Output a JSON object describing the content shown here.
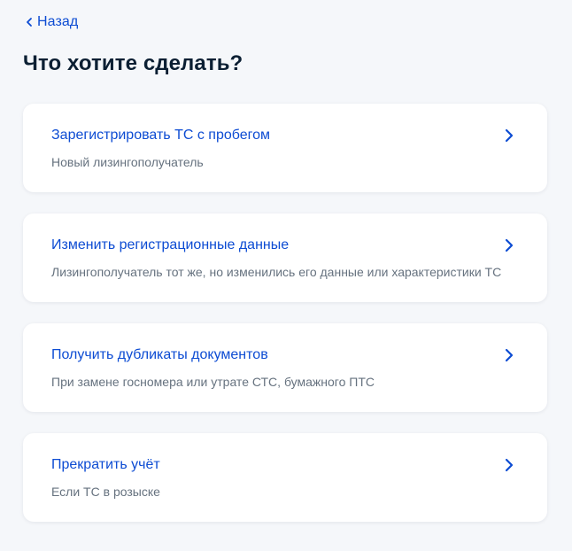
{
  "nav": {
    "back_label": "Назад"
  },
  "page": {
    "title": "Что хотите сделать?"
  },
  "options": [
    {
      "title": "Зарегистрировать ТС с пробегом",
      "description": "Новый лизингополучатель",
      "icon": "chevron-right-icon"
    },
    {
      "title": "Изменить регистрационные данные",
      "description": "Лизингополучатель тот же, но изменились его данные или характеристики ТС",
      "icon": "chevron-right-icon"
    },
    {
      "title": "Получить дубликаты документов",
      "description": "При замене госномера или утрате СТС, бумажного ПТС",
      "icon": "chevron-right-icon"
    },
    {
      "title": "Прекратить учёт",
      "description": "Если ТС в розыске",
      "icon": "chevron-right-icon"
    }
  ],
  "colors": {
    "accent": "#0d4cd3",
    "title": "#0b1f33",
    "muted": "#66727f",
    "background": "#f5f7fa",
    "card": "#ffffff"
  }
}
